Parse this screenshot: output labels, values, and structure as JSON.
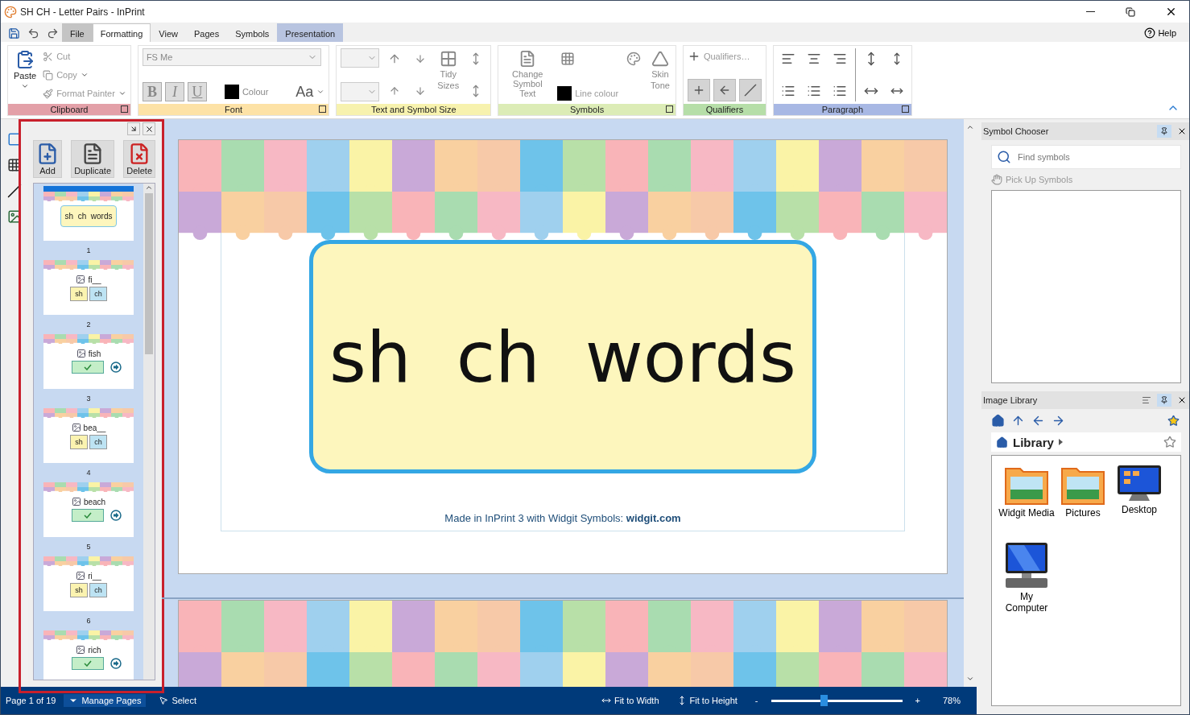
{
  "window": {
    "title": "SH CH - Letter Pairs - InPrint"
  },
  "ribbon_tabs": [
    {
      "label": "File",
      "kind": "file",
      "selected": false
    },
    {
      "label": "Formatting",
      "kind": "tab",
      "selected": true
    },
    {
      "label": "View",
      "kind": "tab",
      "selected": false
    },
    {
      "label": "Pages",
      "kind": "tab",
      "selected": false
    },
    {
      "label": "Symbols",
      "kind": "tab",
      "selected": false
    },
    {
      "label": "Presentation",
      "kind": "context",
      "selected": false
    }
  ],
  "help": "Help",
  "clipboard": {
    "title": "Clipboard",
    "paste": "Paste",
    "cut": "Cut",
    "copy": "Copy",
    "format_painter": "Format Painter"
  },
  "font": {
    "title": "Font",
    "font_name": "FS Me",
    "bold": "B",
    "italic": "I",
    "underline": "U",
    "colour": "Colour",
    "case": "Aa"
  },
  "text_size": {
    "title": "Text and Symbol Size",
    "tidy": "Tidy Sizes"
  },
  "symbols": {
    "title": "Symbols",
    "change_text": "Change Symbol Text",
    "line_colour": "Line colour",
    "skin_tone": "Skin Tone"
  },
  "qualifiers": {
    "title": "Qualifiers",
    "button": "Qualifiers…"
  },
  "paragraph": {
    "title": "Paragraph"
  },
  "pages_panel": {
    "actions": [
      "Add",
      "Duplicate",
      "Delete"
    ],
    "thumbnails": [
      {
        "kind": "title",
        "text": "sh  ch  words",
        "number": "1",
        "selected": true
      },
      {
        "kind": "choice",
        "word": "fi__",
        "options": [
          "sh",
          "ch"
        ],
        "number": "2",
        "selected": false
      },
      {
        "kind": "answer",
        "word": "fish",
        "number": "3",
        "selected": false
      },
      {
        "kind": "choice",
        "word": "bea__",
        "options": [
          "sh",
          "ch"
        ],
        "number": "4",
        "selected": false
      },
      {
        "kind": "answer",
        "word": "beach",
        "number": "5",
        "selected": false
      },
      {
        "kind": "choice",
        "word": "ri__",
        "options": [
          "sh",
          "ch"
        ],
        "number": "6",
        "selected": false
      },
      {
        "kind": "answer",
        "word": "rich",
        "selected": false
      }
    ]
  },
  "document": {
    "title": "sh  ch  words",
    "footer": "Made in InPrint 3 with Widgit Symbols: **widgit.com**"
  },
  "symbol_chooser": {
    "title": "Symbol Chooser",
    "search": {
      "placeholder": "Find symbols"
    },
    "pick_up": "Pick Up Symbols"
  },
  "image_library": {
    "title": "Image Library",
    "breadcrumb": "Library",
    "items": [
      {
        "label": "Widgit Media",
        "kind": "folder"
      },
      {
        "label": "Pictures",
        "kind": "folder"
      },
      {
        "label": "Desktop",
        "kind": "desktop"
      },
      {
        "label": "My Computer",
        "kind": "computer"
      }
    ]
  },
  "status_bar": {
    "page": "Page 1 of 19",
    "manage_pages": "Manage Pages",
    "select": "Select",
    "fit_width": "Fit to Width",
    "fit_height": "Fit to Height",
    "zoom_out": "-",
    "zoom_in": "+",
    "zoom": {
      "level": 0.38
    },
    "zoom_reading": "78%"
  }
}
